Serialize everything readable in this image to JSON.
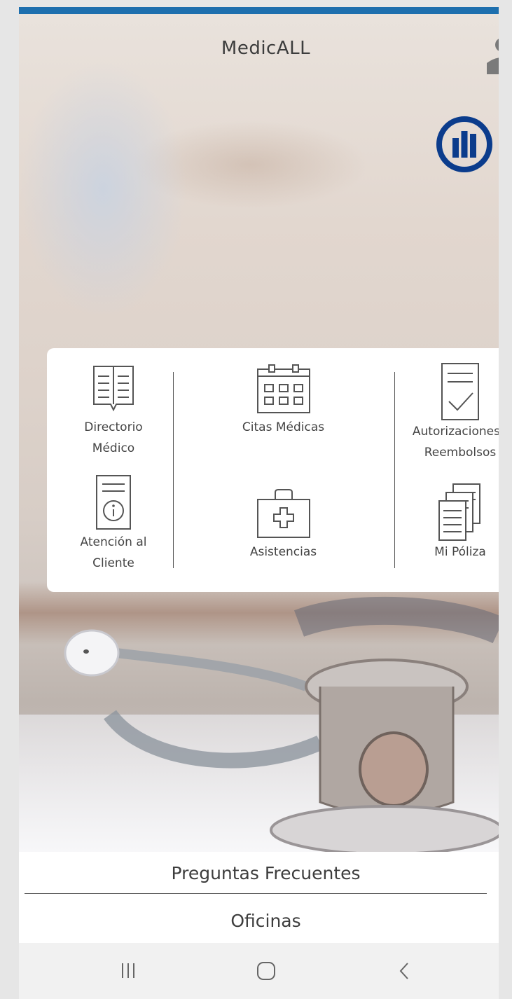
{
  "header": {
    "title": "MedicALL"
  },
  "menu": {
    "items": [
      {
        "id": "directorio",
        "label_line1": "Directorio",
        "label_line2": "Médico",
        "icon": "book-icon"
      },
      {
        "id": "citas",
        "label_line1": "Citas Médicas",
        "label_line2": "",
        "icon": "calendar-icon"
      },
      {
        "id": "autorizaciones",
        "label_line1": "Autorizaciones /",
        "label_line2": "Reembolsos",
        "icon": "checklist-icon"
      },
      {
        "id": "atencion",
        "label_line1": "Atención al",
        "label_line2": "Cliente",
        "icon": "info-document-icon"
      },
      {
        "id": "asistencias",
        "label_line1": "Asistencias",
        "label_line2": "",
        "icon": "medical-kit-icon"
      },
      {
        "id": "poliza",
        "label_line1": "Mi Póliza",
        "label_line2": "",
        "icon": "documents-icon"
      }
    ]
  },
  "links": {
    "faq": "Preguntas Frecuentes",
    "offices": "Oficinas"
  },
  "system_nav": {
    "icons": [
      "recent-apps-icon",
      "home-icon",
      "back-icon"
    ]
  },
  "colors": {
    "accent_bar": "#1d6fae",
    "logo_blue": "#0b3c8c",
    "text": "#3d3d3d"
  }
}
